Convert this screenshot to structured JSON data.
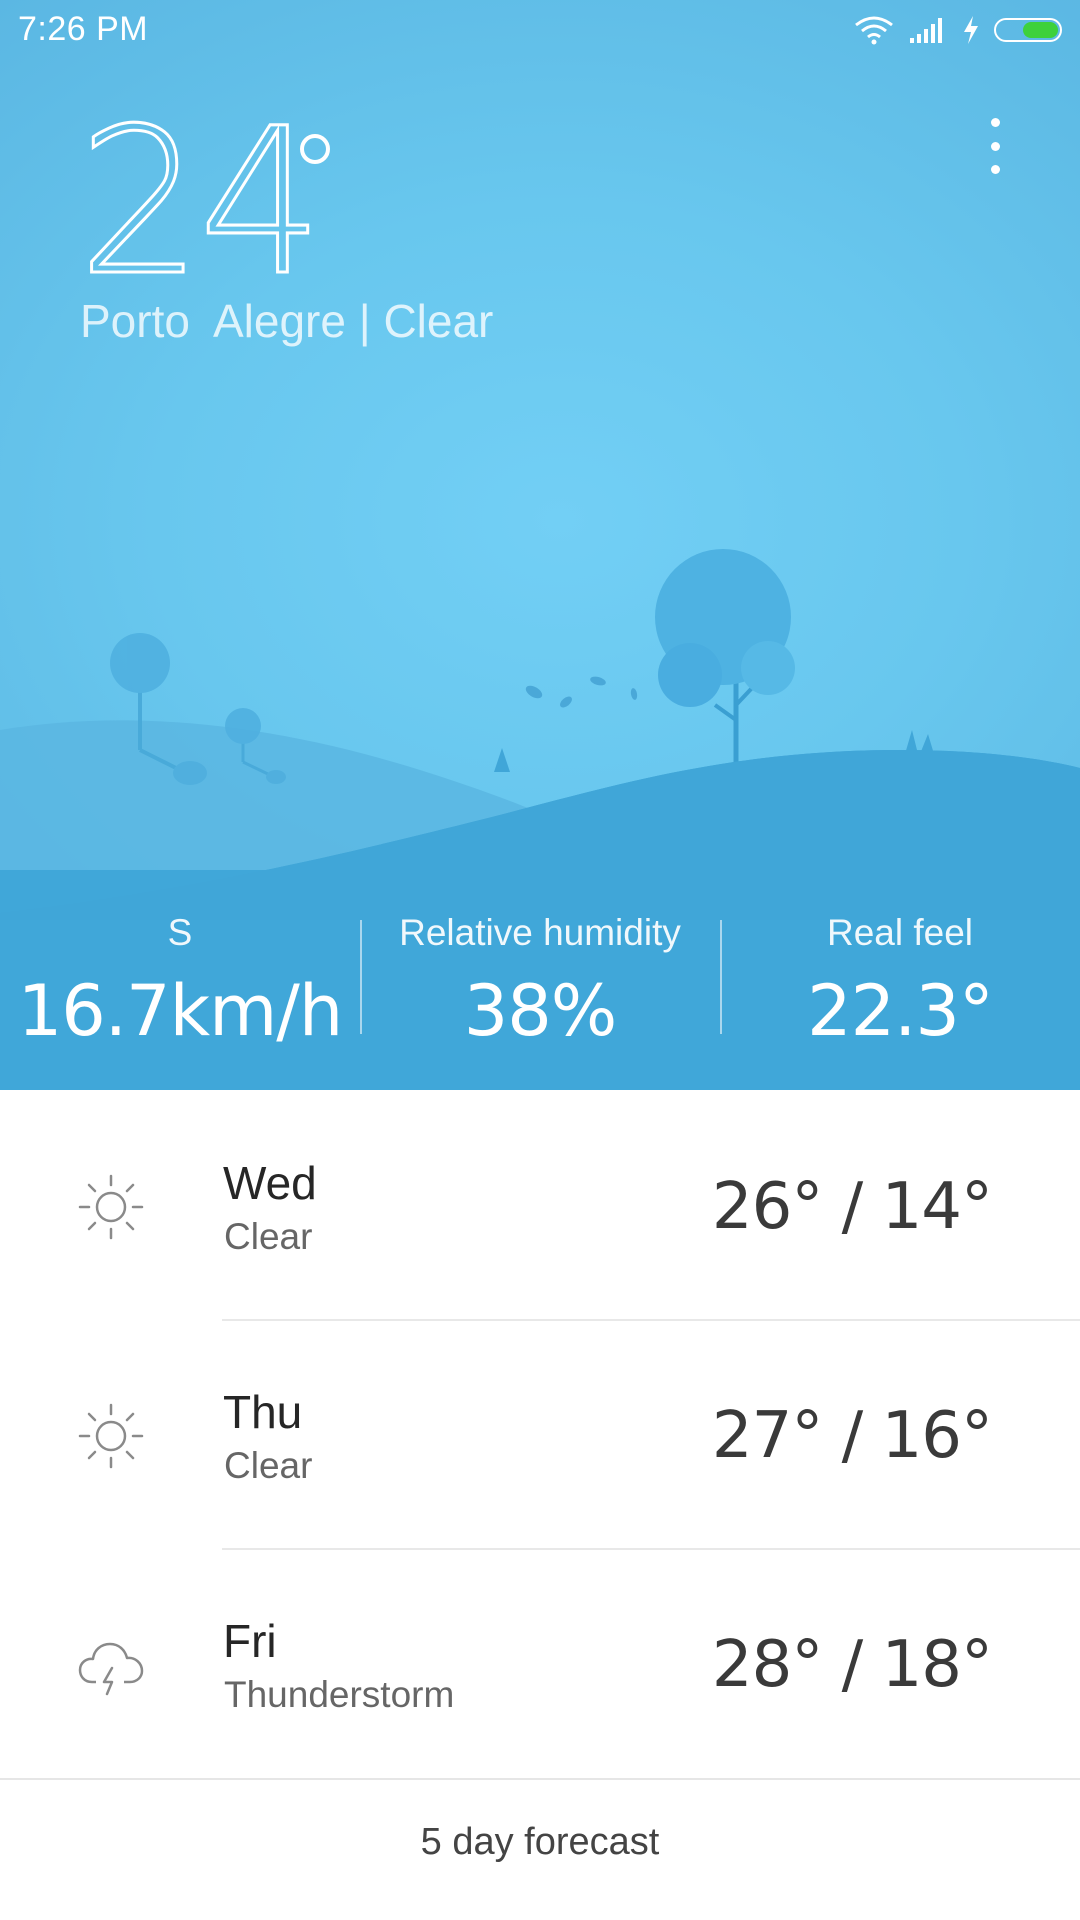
{
  "status_bar": {
    "time": "7:26  PM",
    "icons": [
      "wifi-icon",
      "signal-icon",
      "charging-icon",
      "battery-icon"
    ],
    "battery_level_fraction": 0.55,
    "battery_color": "#3ed13c"
  },
  "current": {
    "temperature": "24",
    "location": "Porto  Alegre",
    "separator": "|",
    "condition": "Clear"
  },
  "menu": {
    "icon": "more-vert-icon"
  },
  "stats": [
    {
      "label": "S",
      "value": "16.7km/h"
    },
    {
      "label": "Relative humidity",
      "value": "38%"
    },
    {
      "label": "Real feel",
      "value": "22.3°"
    }
  ],
  "forecast": [
    {
      "day": "Wed",
      "condition": "Clear",
      "temp": "26° / 14°",
      "icon": "sun-icon"
    },
    {
      "day": "Thu",
      "condition": "Clear",
      "temp": "27° / 16°",
      "icon": "sun-icon"
    },
    {
      "day": "Fri",
      "condition": "Thunderstorm",
      "temp": "28° / 18°",
      "icon": "thunderstorm-icon"
    }
  ],
  "footer": {
    "label": "5 day forecast"
  },
  "colors": {
    "sky": "#68c7ee",
    "hill_back": "#5ab9e6",
    "hill_front": "#40a9da",
    "stats_band": "#42aadb",
    "tree": "#4fb4e2",
    "text_dark": "#262626",
    "text_secondary": "#666666"
  }
}
